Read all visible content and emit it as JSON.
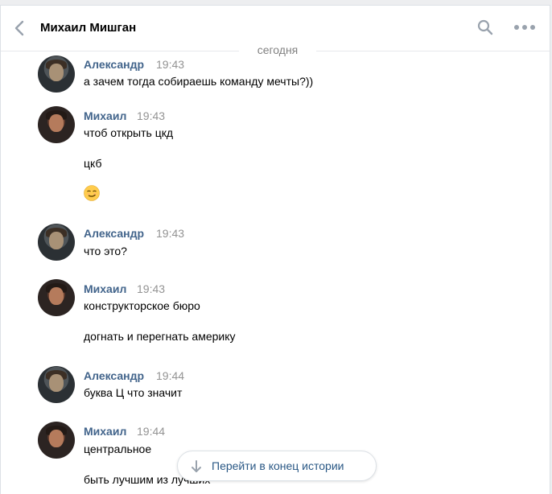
{
  "header": {
    "title": "Михаил Мишган",
    "back_icon": "chevron-left-icon",
    "search_icon": "search-icon",
    "more_icon": "more-horizontal-icon"
  },
  "date_separator": "сегодня",
  "messages": [
    {
      "author": "Александр",
      "time": "19:43",
      "lines": [
        "а зачем тогда собираешь команду мечты?))"
      ]
    },
    {
      "author": "Михаил",
      "time": "19:43",
      "lines": [
        "чтоб открыть цкд",
        "цкб"
      ],
      "emoji": "smirk-emoji"
    },
    {
      "author": "Александр",
      "time": "19:43",
      "lines": [
        "что это?"
      ]
    },
    {
      "author": "Михаил",
      "time": "19:43",
      "lines": [
        "конструкторское бюро",
        "догнать и перегнать америку"
      ]
    },
    {
      "author": "Александр",
      "time": "19:44",
      "lines": [
        "буква Ц что значит"
      ]
    },
    {
      "author": "Михаил",
      "time": "19:44",
      "lines": [
        "центральное",
        "быть лучшим из лучших"
      ]
    }
  ],
  "scroll_to_end": {
    "label": "Перейти в конец истории",
    "icon": "arrow-down-icon"
  },
  "colors": {
    "author": "#42648b",
    "time": "#939393",
    "link": "#2a5885",
    "background": "#edeef0"
  }
}
